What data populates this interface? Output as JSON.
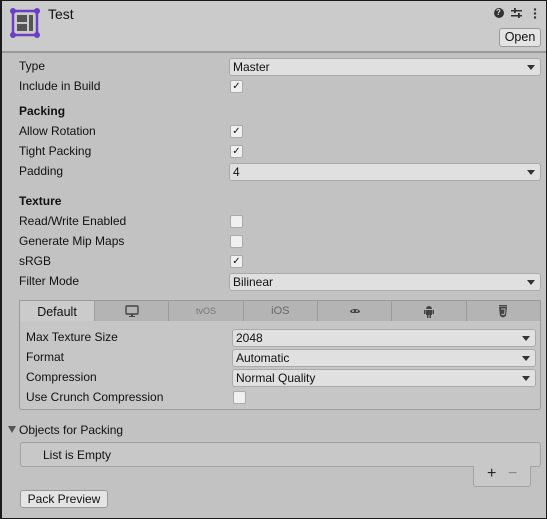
{
  "header": {
    "title": "Test",
    "asset_icon": "sprite-atlas-icon",
    "icons": [
      "help-icon",
      "presets-icon",
      "more-options-icon"
    ],
    "open_label": "Open"
  },
  "fields": {
    "type": {
      "label": "Type",
      "value": "Master"
    },
    "include_in_build": {
      "label": "Include in Build",
      "checked": true,
      "mark": "✓"
    },
    "packing_header": "Packing",
    "allow_rotation": {
      "label": "Allow Rotation",
      "checked": true,
      "mark": "✓"
    },
    "tight_packing": {
      "label": "Tight Packing",
      "checked": true,
      "mark": "✓"
    },
    "padding": {
      "label": "Padding",
      "value": "4"
    },
    "texture_header": "Texture",
    "read_write": {
      "label": "Read/Write Enabled",
      "checked": false,
      "mark": ""
    },
    "mip_maps": {
      "label": "Generate Mip Maps",
      "checked": false,
      "mark": ""
    },
    "srgb": {
      "label": "sRGB",
      "checked": true,
      "mark": "✓"
    },
    "filter_mode": {
      "label": "Filter Mode",
      "value": "Bilinear"
    }
  },
  "platform_tabs": [
    {
      "label": "Default",
      "active": true
    },
    {
      "label": "",
      "icon": "standalone-monitor-icon"
    },
    {
      "label": "tvOS"
    },
    {
      "label": "iOS"
    },
    {
      "label": "",
      "icon": "lumin-icon"
    },
    {
      "label": "",
      "icon": "android-icon"
    },
    {
      "label": "",
      "icon": "webgl-html5-icon"
    }
  ],
  "platform_settings": {
    "max_texture_size": {
      "label": "Max Texture Size",
      "value": "2048"
    },
    "format": {
      "label": "Format",
      "value": "Automatic"
    },
    "compression": {
      "label": "Compression",
      "value": "Normal Quality"
    },
    "crunch": {
      "label": "Use Crunch Compression",
      "checked": false,
      "mark": ""
    }
  },
  "objects_for_packing": {
    "label": "Objects for Packing",
    "empty_text": "List is Empty",
    "add_label": "+",
    "remove_label": "−"
  },
  "pack_preview_label": "Pack Preview"
}
